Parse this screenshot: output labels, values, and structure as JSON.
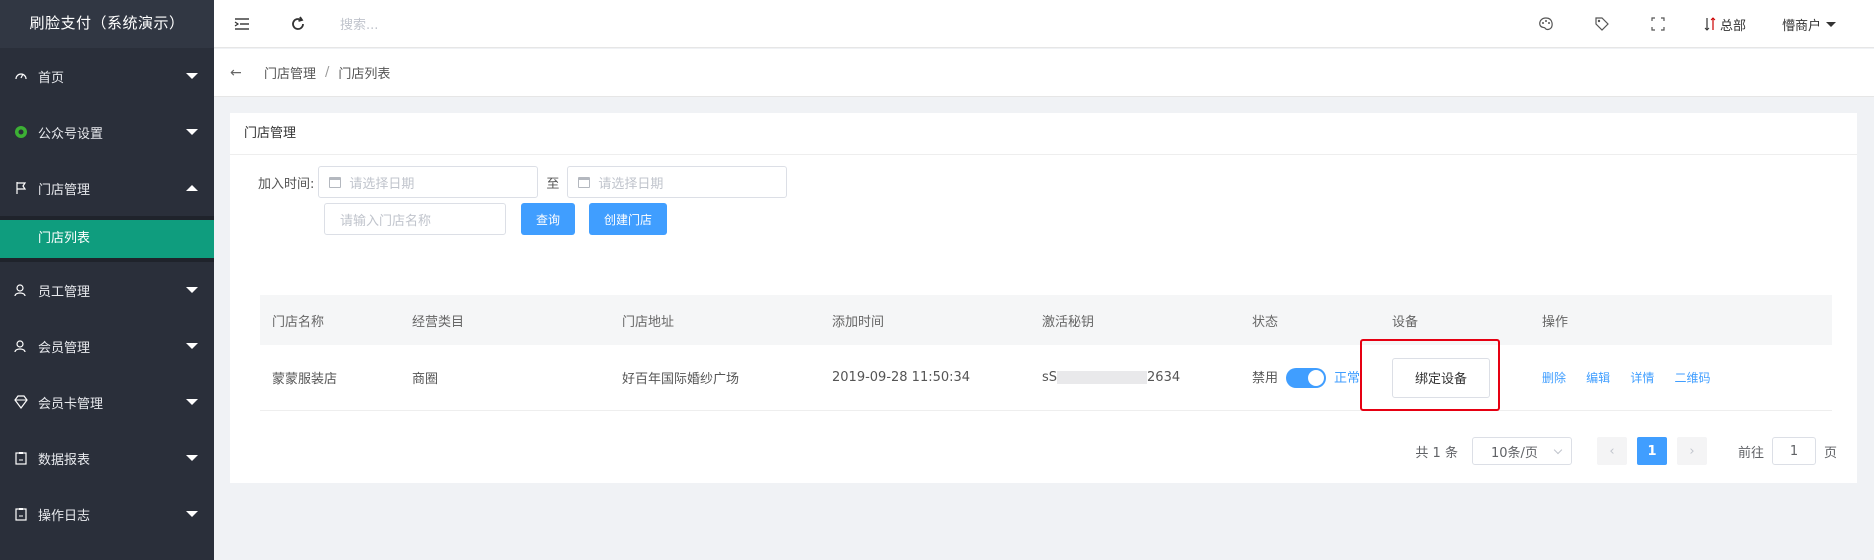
{
  "app": {
    "title": "刷脸支付（系统演示）"
  },
  "sidebar": {
    "items": [
      {
        "label": "首页",
        "icon": "dashboard-icon"
      },
      {
        "label": "公众号设置",
        "icon": "wechat-icon"
      },
      {
        "label": "门店管理",
        "icon": "flag-icon",
        "expanded": true,
        "children": [
          {
            "label": "门店列表",
            "active": true
          }
        ]
      },
      {
        "label": "员工管理",
        "icon": "user-icon"
      },
      {
        "label": "会员管理",
        "icon": "user-icon"
      },
      {
        "label": "会员卡管理",
        "icon": "diamond-icon"
      },
      {
        "label": "数据报表",
        "icon": "clipboard-icon"
      },
      {
        "label": "操作日志",
        "icon": "clipboard-icon"
      }
    ]
  },
  "header": {
    "search_placeholder": "搜索...",
    "branch_label": "总部",
    "user_label": "懵商户"
  },
  "breadcrumb": {
    "items": [
      "门店管理",
      "门店列表"
    ],
    "separator": "/"
  },
  "card": {
    "title": "门店管理",
    "filter": {
      "join_time_label": "加入时间:",
      "start_placeholder": "请选择日期",
      "to_label": "至",
      "end_placeholder": "请选择日期",
      "store_name_placeholder": "请输入门店名称",
      "query_button": "查询",
      "create_button": "创建门店"
    }
  },
  "table": {
    "columns": [
      "门店名称",
      "经营类目",
      "门店地址",
      "添加时间",
      "激活秘钥",
      "状态",
      "设备",
      "操作"
    ],
    "rows": [
      {
        "name": "蒙蒙服装店",
        "category": "商圈",
        "address": "好百年国际婚纱广场",
        "added_time": "2019-09-28 11:50:34",
        "key_prefix": "sS",
        "key_suffix": "2634",
        "status_off": "禁用",
        "status_on": "正常",
        "device_button": "绑定设备",
        "actions": [
          "删除",
          "编辑",
          "详情",
          "二维码"
        ]
      }
    ]
  },
  "pagination": {
    "total_text": "共 1 条",
    "page_size": "10条/页",
    "current_page": "1",
    "goto_label": "前往",
    "goto_value": "1",
    "page_unit": "页"
  },
  "colors": {
    "accent": "#409eff",
    "sidebar_bg": "#2a2f3a",
    "active_menu": "#0f9d7e",
    "highlight_box": "#e60012"
  }
}
